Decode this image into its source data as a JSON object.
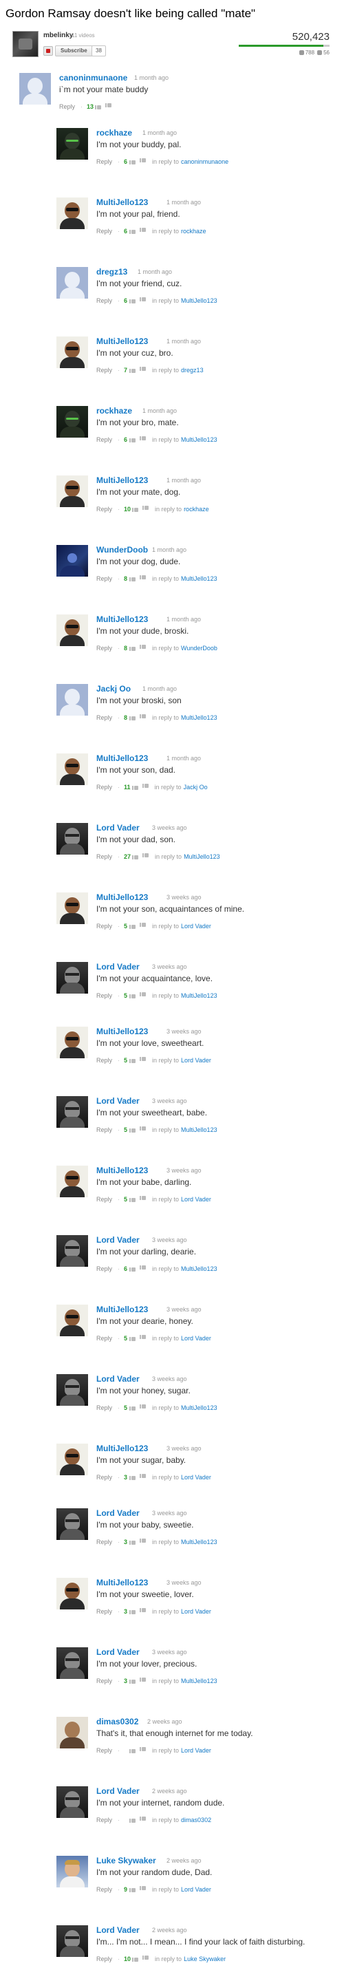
{
  "video": {
    "title": "Gordon Ramsay doesn't like being called \"mate\"",
    "channel_name": "mbelinky",
    "channel_videos": "11 videos",
    "subscribe_label": "Subscribe",
    "subscriber_count": "38",
    "views": "520,423",
    "likes": "788",
    "dislikes": "56",
    "like_ratio": 0.93,
    "colors": {
      "link": "#167ac6",
      "likes_green": "#2b9a2b",
      "meta_gray": "#999999"
    }
  },
  "comments": {
    "reply_label": "Reply",
    "in_reply_prefix": "in reply to",
    "items": [
      {
        "author": "canoninmunaone",
        "avatar": "default-avatar-icon",
        "time": "1 month ago",
        "text": "i`m not your mate buddy",
        "likes": "13",
        "in_reply_to": ""
      },
      {
        "author": "rockhaze",
        "avatar": "rockhaze-avatar",
        "time": "1 month ago",
        "text": "I'm not your buddy, pal.",
        "likes": "6",
        "in_reply_to": "canoninmunaone"
      },
      {
        "author": "MultiJello123",
        "avatar": "multijello-avatar",
        "time": "1 month ago",
        "text": "I'm not your pal, friend.",
        "likes": "6",
        "in_reply_to": "rockhaze"
      },
      {
        "author": "dregz13",
        "avatar": "default-avatar-icon",
        "time": "1 month ago",
        "text": "I'm not your friend, cuz.",
        "likes": "6",
        "in_reply_to": "MultiJello123"
      },
      {
        "author": "MultiJello123",
        "avatar": "multijello-avatar",
        "time": "1 month ago",
        "text": "I'm not your cuz, bro.",
        "likes": "7",
        "in_reply_to": "dregz13"
      },
      {
        "author": "rockhaze",
        "avatar": "rockhaze-avatar",
        "time": "1 month ago",
        "text": "I'm not your bro, mate.",
        "likes": "6",
        "in_reply_to": "MultiJello123"
      },
      {
        "author": "MultiJello123",
        "avatar": "multijello-avatar",
        "time": "1 month ago",
        "text": "I'm not your mate, dog.",
        "likes": "10",
        "in_reply_to": "rockhaze"
      },
      {
        "author": "WunderDoob",
        "avatar": "wunderdoob-avatar",
        "time": "1 month ago",
        "text": "I'm not your dog, dude.",
        "likes": "8",
        "in_reply_to": "MultiJello123"
      },
      {
        "author": "MultiJello123",
        "avatar": "multijello-avatar",
        "time": "1 month ago",
        "text": "I'm not your dude, broski.",
        "likes": "8",
        "in_reply_to": "WunderDoob"
      },
      {
        "author": "Jackj Oo",
        "avatar": "default-avatar-icon",
        "time": "1 month ago",
        "text": "I'm not your broski, son",
        "likes": "8",
        "in_reply_to": "MultiJello123"
      },
      {
        "author": "MultiJello123",
        "avatar": "multijello-avatar",
        "time": "1 month ago",
        "text": "I'm not your son, dad.",
        "likes": "11",
        "in_reply_to": "Jackj Oo"
      },
      {
        "author": "Lord Vader",
        "avatar": "vader-avatar",
        "time": "3 weeks ago",
        "text": "I'm not your dad, son.",
        "likes": "27",
        "in_reply_to": "MultiJello123"
      },
      {
        "author": "MultiJello123",
        "avatar": "multijello-avatar",
        "time": "3 weeks ago",
        "text": "I'm not your son, acquaintances of mine.",
        "likes": "5",
        "in_reply_to": "Lord Vader"
      },
      {
        "author": "Lord Vader",
        "avatar": "vader-avatar",
        "time": "3 weeks ago",
        "text": "I'm not your acquaintance, love.",
        "likes": "5",
        "in_reply_to": "MultiJello123"
      },
      {
        "author": "MultiJello123",
        "avatar": "multijello-avatar",
        "time": "3 weeks ago",
        "text": "I'm not your love, sweetheart.",
        "likes": "5",
        "in_reply_to": "Lord Vader"
      },
      {
        "author": "Lord Vader",
        "avatar": "vader-avatar",
        "time": "3 weeks ago",
        "text": "I'm not your sweetheart, babe.",
        "likes": "5",
        "in_reply_to": "MultiJello123"
      },
      {
        "author": "MultiJello123",
        "avatar": "multijello-avatar",
        "time": "3 weeks ago",
        "text": "I'm not your babe, darling.",
        "likes": "5",
        "in_reply_to": "Lord Vader"
      },
      {
        "author": "Lord Vader",
        "avatar": "vader-avatar",
        "time": "3 weeks ago",
        "text": "I'm not your darling, dearie.",
        "likes": "6",
        "in_reply_to": "MultiJello123"
      },
      {
        "author": "MultiJello123",
        "avatar": "multijello-avatar",
        "time": "3 weeks ago",
        "text": "I'm not your dearie, honey.",
        "likes": "5",
        "in_reply_to": "Lord Vader"
      },
      {
        "author": "Lord Vader",
        "avatar": "vader-avatar",
        "time": "3 weeks ago",
        "text": "I'm not your honey, sugar.",
        "likes": "5",
        "in_reply_to": "MultiJello123"
      },
      {
        "author": "MultiJello123",
        "avatar": "multijello-avatar",
        "time": "3 weeks ago",
        "text": "I'm not your sugar, baby.",
        "likes": "3",
        "in_reply_to": "Lord Vader"
      },
      {
        "author": "Lord Vader",
        "avatar": "vader-avatar",
        "time": "3 weeks ago",
        "text": "I'm not your baby, sweetie.",
        "likes": "3",
        "in_reply_to": "MultiJello123"
      },
      {
        "author": "MultiJello123",
        "avatar": "multijello-avatar",
        "time": "3 weeks ago",
        "text": "I'm not your sweetie, lover.",
        "likes": "3",
        "in_reply_to": "Lord Vader"
      },
      {
        "author": "Lord Vader",
        "avatar": "vader-avatar",
        "time": "3 weeks ago",
        "text": "I'm not your lover, precious.",
        "likes": "3",
        "in_reply_to": "MultiJello123"
      },
      {
        "author": "dimas0302",
        "avatar": "dimas-avatar",
        "time": "2 weeks ago",
        "text": "That's it, that enough internet for me today.",
        "likes": "",
        "in_reply_to": "Lord Vader"
      },
      {
        "author": "Lord Vader",
        "avatar": "vader-avatar",
        "time": "2 weeks ago",
        "text": "I'm not your internet, random dude.",
        "likes": "",
        "in_reply_to": "dimas0302"
      },
      {
        "author": "Luke Skywaker",
        "avatar": "luke-avatar",
        "time": "2 weeks ago",
        "text": "I'm not your random dude, Dad.",
        "likes": "9",
        "in_reply_to": "Lord Vader"
      },
      {
        "author": "Lord Vader",
        "avatar": "vader-avatar",
        "time": "2 weeks ago",
        "text": "I'm... I'm not... I mean... I find your lack of faith disturbing.",
        "likes": "10",
        "in_reply_to": "Luke Skywaker"
      }
    ]
  }
}
